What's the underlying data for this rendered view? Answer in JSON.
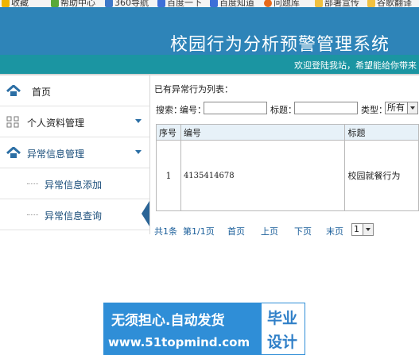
{
  "bookmarks": [
    {
      "label": "收藏",
      "icon": "star-icon"
    },
    {
      "label": "帮助中心",
      "icon": "help-icon"
    },
    {
      "label": "360导航",
      "icon": "nav-icon"
    },
    {
      "label": "百度一下",
      "icon": "baidu-paw-icon"
    },
    {
      "label": "百度知道",
      "icon": "baidu-paw-icon"
    },
    {
      "label": "问题库",
      "icon": "sogou-icon"
    },
    {
      "label": "部署宣传",
      "icon": "folder-icon"
    },
    {
      "label": "谷歌翻译",
      "icon": "translate-icon"
    }
  ],
  "header": {
    "title": "校园行为分析预警管理系统",
    "welcome": "欢迎登陆我站，希望能给你带来"
  },
  "sidebar": {
    "items": [
      {
        "label": "首页",
        "icon": "home-icon"
      },
      {
        "label": "个人资料管理",
        "icon": "grid-icon"
      },
      {
        "label": "异常信息管理",
        "icon": "home-icon"
      },
      {
        "label": "异常信息添加"
      },
      {
        "label": "异常信息查询"
      }
    ]
  },
  "main": {
    "heading": "已有异常行为列表：",
    "search": {
      "label": "搜索：",
      "id_label": "编号：",
      "id_value": "",
      "title_label": "标题：",
      "title_value": "",
      "type_label": "类型：",
      "type_value": "所有"
    },
    "table": {
      "columns": [
        "序号",
        "编号",
        "标题"
      ],
      "rows": [
        {
          "seq": "1",
          "id": "4135414678",
          "title": "校园就餐行为"
        }
      ]
    },
    "pagination": {
      "total": "共1条",
      "page_info": "第1/1页",
      "first": "首页",
      "prev": "上页",
      "next": "下页",
      "last": "末页",
      "page_select": "1"
    }
  },
  "watermark": {
    "line1": "无须担心.自动发货",
    "line2": "www.51topmind.com",
    "badge1": "毕业",
    "badge2": "设计"
  },
  "colors": {
    "header": "#2e84b8",
    "welcome_bar": "#1b95a2",
    "accent": "#2c6fa5",
    "watermark": "#2f8ed7"
  }
}
